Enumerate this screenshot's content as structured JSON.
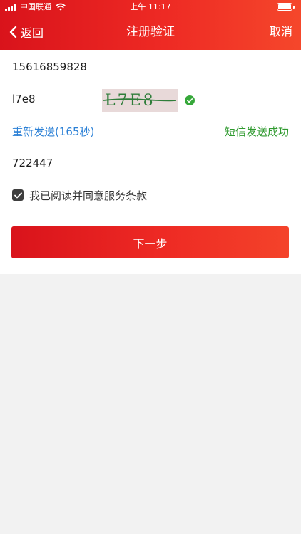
{
  "status_bar": {
    "carrier": "中国联通",
    "time": "上午 11:17"
  },
  "nav": {
    "back_label": "返回",
    "title": "注册验证",
    "cancel_label": "取消"
  },
  "form": {
    "phone": "15616859828",
    "captcha_input": "l7e8",
    "captcha_image_text": "L7E8",
    "resend_label": "重新发送(165秒)",
    "sms_status": "短信发送成功",
    "sms_code": "722447",
    "agree_label": "我已阅读并同意服务条款",
    "agree_checked": true,
    "next_label": "下一步"
  },
  "colors": {
    "brand_red": "#e8201f",
    "link_blue": "#2b80d6",
    "success_green": "#2f9a2f"
  }
}
